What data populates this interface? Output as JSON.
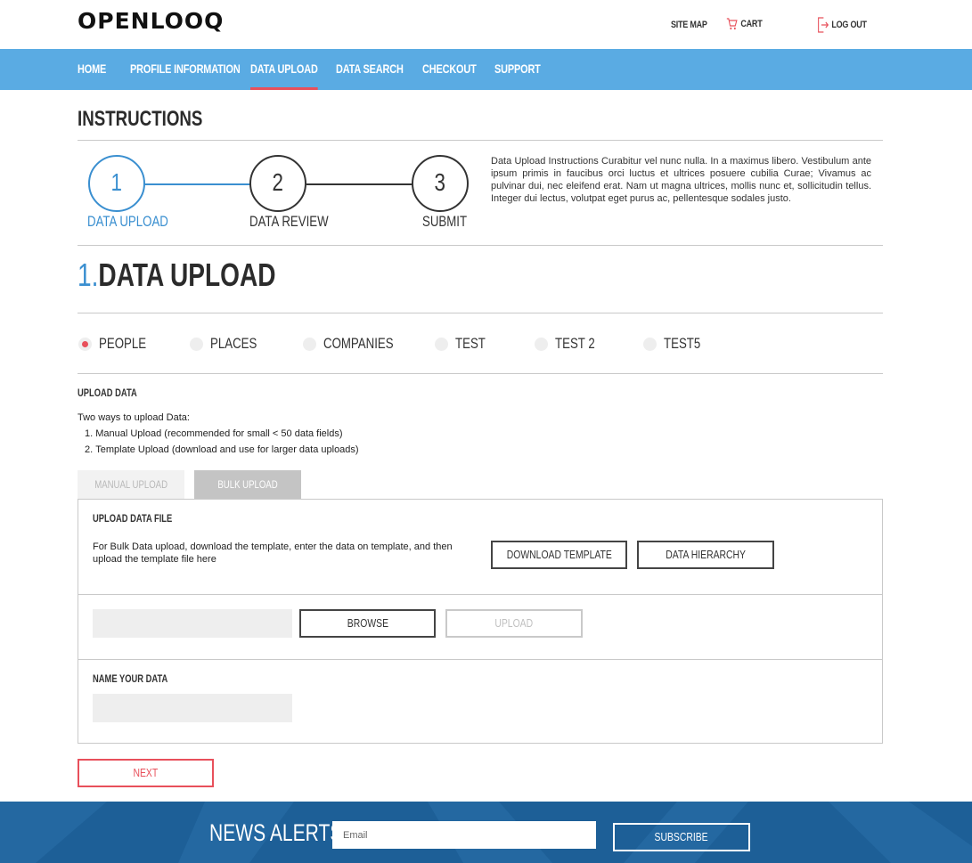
{
  "header": {
    "logo": "OPENLOOQ",
    "site_map": "SITE MAP",
    "cart": "CART",
    "logout": "LOG OUT"
  },
  "nav": {
    "items": [
      {
        "label": "HOME"
      },
      {
        "label": "PROFILE INFORMATION"
      },
      {
        "label": "DATA UPLOAD",
        "active": true
      },
      {
        "label": "DATA SEARCH"
      },
      {
        "label": "CHECKOUT"
      },
      {
        "label": "SUPPORT"
      }
    ]
  },
  "instructions": {
    "title": "INSTRUCTIONS",
    "steps": [
      {
        "number": "1",
        "label": "DATA UPLOAD",
        "active": true
      },
      {
        "number": "2",
        "label": "DATA REVIEW"
      },
      {
        "number": "3",
        "label": "SUBMIT"
      }
    ],
    "text": "Data Upload Instructions Curabitur vel nunc nulla. In a maximus libero. Vestibulum ante ipsum primis in faucibus orci luctus et ultrices posuere cubilia Curae; Vivamus ac pulvinar dui, nec eleifend erat. Nam ut magna ultrices, mollis nunc et, sollicitudin tellus. Integer dui lectus, volutpat eget purus ac, pellentesque sodales justo."
  },
  "section": {
    "number": "1.",
    "title": "DATA UPLOAD"
  },
  "categories": {
    "options": [
      {
        "label": "PEOPLE",
        "selected": true
      },
      {
        "label": "PLACES"
      },
      {
        "label": "COMPANIES"
      },
      {
        "label": "TEST"
      },
      {
        "label": "TEST 2"
      },
      {
        "label": "TEST5"
      }
    ]
  },
  "upload": {
    "heading": "UPLOAD DATA",
    "intro": "Two ways to upload Data:",
    "ways": [
      "Manual Upload (recommended for small < 50 data fields)",
      "Template Upload (download and use for larger data uploads)"
    ],
    "tabs": {
      "manual": "MANUAL UPLOAD",
      "bulk": "BULK UPLOAD"
    },
    "file_heading": "UPLOAD DATA FILE",
    "file_desc": "For Bulk Data upload, download the template, enter the data on template, and then upload the template file here",
    "download_template": "DOWNLOAD TEMPLATE",
    "data_hierarchy": "DATA HIERARCHY",
    "file_value": "",
    "browse": "BROWSE",
    "upload": "UPLOAD",
    "name_heading": "NAME YOUR DATA",
    "name_value": "",
    "next": "NEXT"
  },
  "footer": {
    "title": "NEWS ALERTS",
    "email_placeholder": "Email",
    "subscribe": "SUBSCRIBE"
  },
  "colors": {
    "nav_blue": "#5aabe3",
    "accent_blue": "#3a8fd0",
    "accent_red": "#e8505b",
    "footer_blue": "#1d5f97"
  }
}
